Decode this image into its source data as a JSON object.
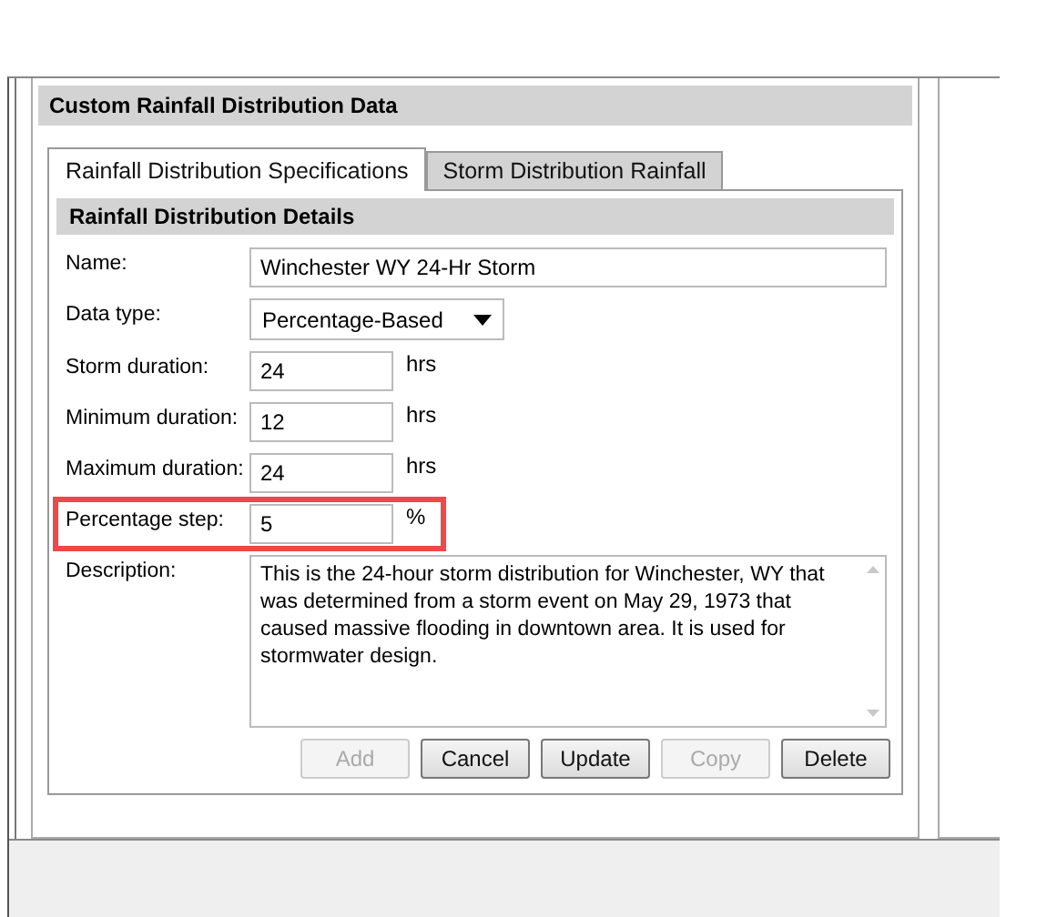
{
  "panel": {
    "title": "Custom Rainfall Distribution Data"
  },
  "tabs": [
    {
      "label": "Rainfall Distribution Specifications",
      "selected": true
    },
    {
      "label": "Storm Distribution Rainfall",
      "selected": false
    }
  ],
  "section": {
    "title": "Rainfall Distribution Details"
  },
  "fields": [
    {
      "kind": "text",
      "label": "Name:",
      "value": "Winchester WY 24-Hr Storm",
      "highlighted": false
    },
    {
      "kind": "dropdown",
      "label": "Data type:",
      "value": "Percentage-Based",
      "highlighted": false
    },
    {
      "kind": "number",
      "label": "Storm duration:",
      "value": "24",
      "unit": "hrs",
      "highlighted": false
    },
    {
      "kind": "number",
      "label": "Minimum duration:",
      "value": "12",
      "unit": "hrs",
      "highlighted": false
    },
    {
      "kind": "number",
      "label": "Maximum duration:",
      "value": "24",
      "unit": "hrs",
      "highlighted": false
    },
    {
      "kind": "number",
      "label": "Percentage step:",
      "value": "5",
      "unit": "%",
      "highlighted": true
    },
    {
      "kind": "textarea",
      "label": "Description:",
      "value": "This is the 24-hour storm distribution for Winchester, WY that was determined from a storm event on May 29, 1973 that caused massive flooding in downtown area. It is used for stormwater design.",
      "highlighted": false
    }
  ],
  "buttons": [
    {
      "label": "Add",
      "disabled": true
    },
    {
      "label": "Cancel",
      "disabled": false
    },
    {
      "label": "Update",
      "disabled": false
    },
    {
      "label": "Copy",
      "disabled": true
    },
    {
      "label": "Delete",
      "disabled": false
    }
  ]
}
